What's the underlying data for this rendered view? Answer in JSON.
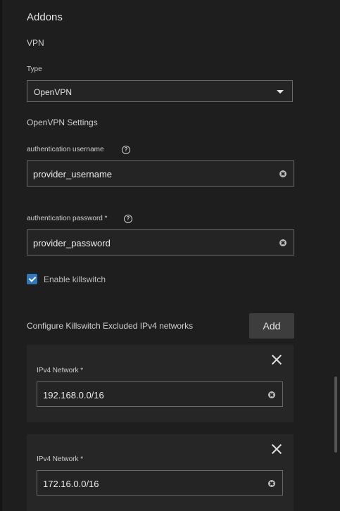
{
  "section_title": "Addons",
  "vpn_label": "VPN",
  "type_field": {
    "label": "Type",
    "value": "OpenVPN"
  },
  "openvpn_settings_label": "OpenVPN Settings",
  "username_field": {
    "label": "authentication username",
    "value": "provider_username"
  },
  "password_field": {
    "label": "authentication password *",
    "value": "provider_password"
  },
  "killswitch": {
    "label": "Enable killswitch",
    "checked": true
  },
  "excluded_networks": {
    "label": "Configure Killswitch Excluded IPv4 networks",
    "add_label": "Add",
    "items": [
      {
        "label": "IPv4 Network *",
        "value": "192.168.0.0/16"
      },
      {
        "label": "IPv4 Network *",
        "value": "172.16.0.0/16"
      }
    ]
  },
  "help_glyph": "?",
  "icons": [
    "help-icon",
    "clear-icon",
    "close-icon",
    "chevron-down-icon",
    "check-icon"
  ],
  "colors": {
    "background": "#1e1e1e",
    "accent": "#2f78b9",
    "card": "#262626"
  }
}
